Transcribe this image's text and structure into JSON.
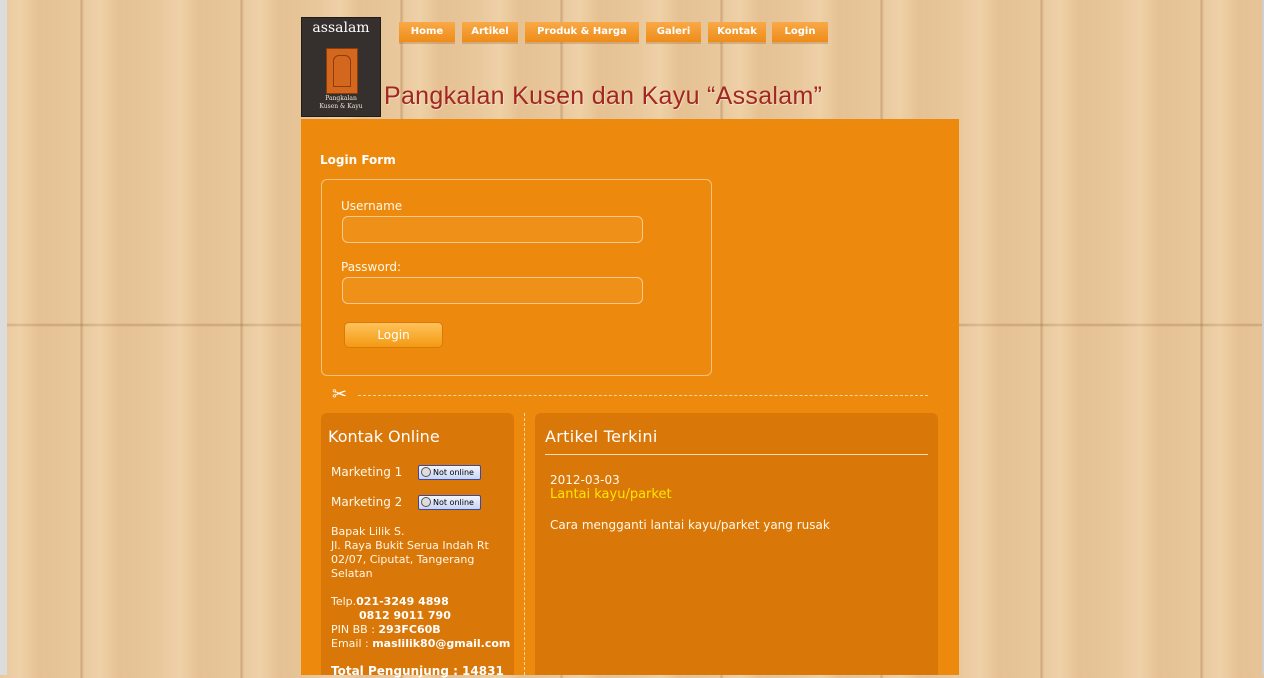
{
  "header": {
    "logo_title": "assalam",
    "logo_subtitle_line1": "Pangkalan",
    "logo_subtitle_line2": "Kusen & Kayu",
    "site_title": "Pangkalan Kusen dan Kayu “Assalam”"
  },
  "nav": {
    "items": [
      {
        "label": "Home"
      },
      {
        "label": "Artikel"
      },
      {
        "label": "Produk & Harga"
      },
      {
        "label": "Galeri"
      },
      {
        "label": "Kontak"
      },
      {
        "label": "Login"
      }
    ]
  },
  "login": {
    "heading": "Login Form",
    "username_label": "Username",
    "username_value": "",
    "password_label": "Password:",
    "password_value": "",
    "button_label": "Login"
  },
  "kontak": {
    "title": "Kontak Online",
    "marketing": [
      {
        "label": "Marketing 1",
        "status": "Not online"
      },
      {
        "label": "Marketing 2",
        "status": "Not online"
      }
    ],
    "address_line1": "Bapak Lilik S.",
    "address_line2": "Jl. Raya Bukit Serua Indah Rt 02/07, Ciputat, Tangerang Selatan",
    "telp_prefix": "Telp.",
    "telp_1": "021-3249 4898",
    "telp_2": "0812 9011 790",
    "pin_prefix": "PIN BB : ",
    "pin": "293FC60B",
    "email_prefix": "Email : ",
    "email": "maslilik80@gmail.com",
    "total_visitors": "Total Pengunjung : 14831"
  },
  "artikel": {
    "title": "Artikel Terkini",
    "items": [
      {
        "date": "2012-03-03",
        "title": "Lantai kayu/parket",
        "summary": "Cara mengganti lantai kayu/parket yang rusak"
      }
    ]
  },
  "colors": {
    "content_bg": "#ed8a0d",
    "panel_bg": "#d97709",
    "site_title": "#a1271f",
    "article_link": "#ffe600"
  }
}
